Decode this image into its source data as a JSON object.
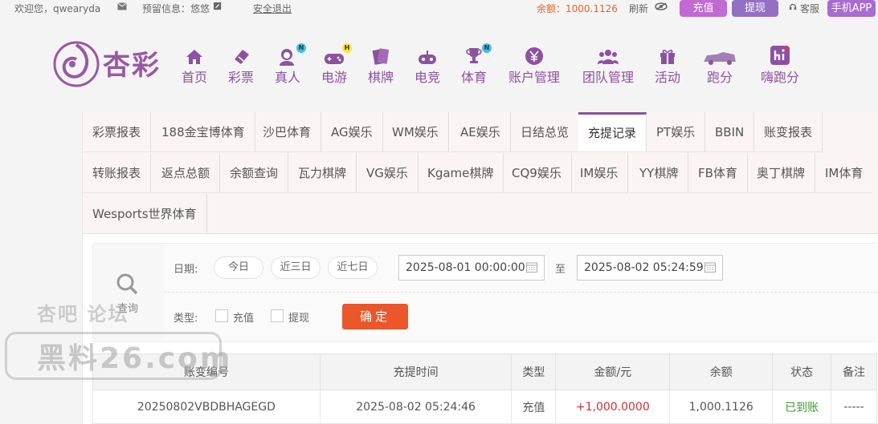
{
  "topbar": {
    "welcome": "欢迎您，qwearyda",
    "reserved_info": "预留信息：悠悠",
    "logout": "安全退出",
    "balance": "余额：1000.1126",
    "refresh": "刷新",
    "recharge": "充值",
    "withdraw": "提现",
    "service": "客服",
    "app": "手机APP"
  },
  "logo": {
    "text": "杏彩"
  },
  "nav": [
    {
      "label": "首页",
      "icon": "home-icon"
    },
    {
      "label": "彩票",
      "icon": "ticket-icon"
    },
    {
      "label": "真人",
      "icon": "dealer-icon",
      "badge": "N"
    },
    {
      "label": "电游",
      "icon": "gamepad-icon",
      "badge": "H"
    },
    {
      "label": "棋牌",
      "icon": "cards-icon"
    },
    {
      "label": "电竞",
      "icon": "joystick-icon"
    },
    {
      "label": "体育",
      "icon": "trophy-icon",
      "badge": "N"
    },
    {
      "label": "账户管理",
      "icon": "yen-icon"
    },
    {
      "label": "团队管理",
      "icon": "team-icon"
    },
    {
      "label": "活动",
      "icon": "gift-icon"
    },
    {
      "label": "跑分",
      "icon": "car-icon"
    },
    {
      "label": "嗨跑分",
      "icon": "hi-icon"
    }
  ],
  "tabs": {
    "row1": [
      "彩票报表",
      "188金宝博体育",
      "沙巴体育",
      "AG娱乐",
      "WM娱乐",
      "AE娱乐",
      "日结总览",
      "充提记录",
      "PT娱乐",
      "BBIN",
      "账变报表"
    ],
    "row2": [
      "转账报表",
      "返点总额",
      "余额查询",
      "瓦力棋牌",
      "VG娱乐",
      "Kgame棋牌",
      "CQ9娱乐",
      "IM娱乐",
      "YY棋牌",
      "FB体育",
      "奥丁棋牌",
      "IM体育"
    ],
    "row3": [
      "Wesports世界体育"
    ],
    "active": "充提记录"
  },
  "filter": {
    "query": "查询",
    "date_label": "日期:",
    "chips": [
      "今日",
      "近三日",
      "近七日"
    ],
    "start": "2025-08-01 00:00:00",
    "to": "至",
    "end": "2025-08-02 05:24:59",
    "type_label": "类型:",
    "types": [
      "充值",
      "提现"
    ],
    "confirm": "确定"
  },
  "table": {
    "headers": [
      "账变编号",
      "充提时间",
      "类型",
      "金额/元",
      "余额",
      "状态",
      "备注"
    ],
    "rows": [
      [
        "20250802VBDBHAGEGD",
        "2025-08-02 05:24:46",
        "充值",
        "+1,000.0000",
        "1,000.1126",
        "已到账",
        "-----"
      ]
    ]
  },
  "watermark": {
    "line1": "杏吧    论坛",
    "line2": "黑料26.com"
  },
  "colors": {
    "brand": "#8e51a1",
    "balance": "#e0642a",
    "confirm": "#e9572a",
    "positive": "#d32f2f",
    "status_ok": "#3a9a2f"
  }
}
